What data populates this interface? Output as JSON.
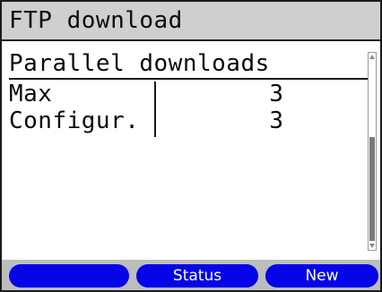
{
  "window": {
    "title": "FTP download"
  },
  "section": {
    "header": "Parallel downloads",
    "rows": [
      {
        "label": "Max",
        "value": "3"
      },
      {
        "label": "Configur.",
        "value": "3"
      }
    ]
  },
  "scrollbar": {
    "thumb_start_fraction": 0.42,
    "thumb_end_fraction": 1.0
  },
  "softkeys": [
    {
      "label": ""
    },
    {
      "label": "Status"
    },
    {
      "label": "New"
    }
  ],
  "colors": {
    "titlebar_bg": "#cfcfcf",
    "softkey_blue": "#0505e8",
    "softkey_bar_bg": "#bdbdbd"
  }
}
